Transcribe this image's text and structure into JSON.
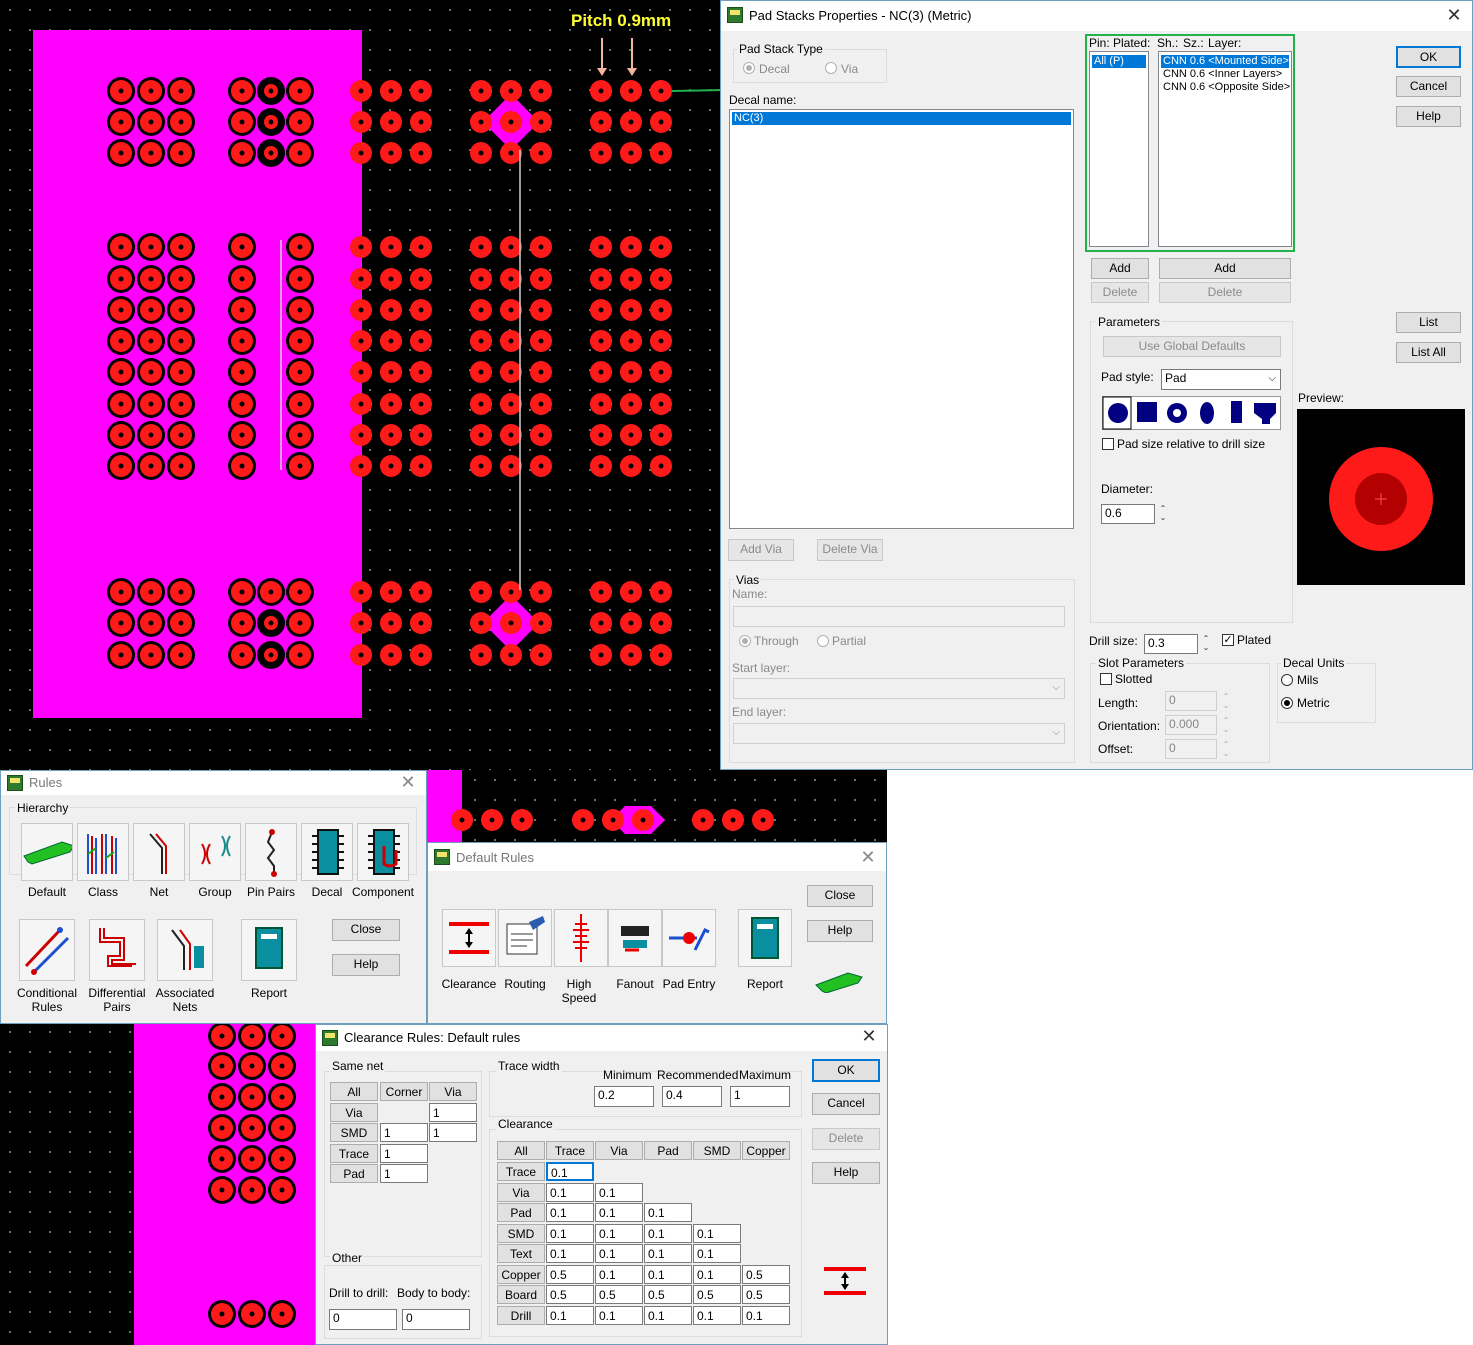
{
  "annotation": {
    "pitch_label": "Pitch 0.9mm"
  },
  "padstack": {
    "title": "Pad Stacks Properties - NC(3) (Metric)",
    "pad_stack_type_label": "Pad Stack Type",
    "decal_radio": "Decal",
    "via_radio": "Via",
    "decal_name_label": "Decal name:",
    "decal_items": [
      "NC(3)"
    ],
    "pin_header": "Pin:",
    "plated_header": "Plated:",
    "sh_header": "Sh.:",
    "sz_header": "Sz.:",
    "layer_header": "Layer:",
    "pin_items": [
      "All (P)"
    ],
    "layer_items": [
      "CNN 0.6 <Mounted Side>",
      "CNN 0.6 <Inner Layers>",
      "CNN 0.6 <Opposite Side>"
    ],
    "add_label": "Add",
    "delete_label": "Delete",
    "parameters_label": "Parameters",
    "use_global_defaults": "Use Global Defaults",
    "pad_style_label": "Pad style:",
    "pad_style_value": "Pad",
    "pad_relative_label": "Pad size relative to drill size",
    "diameter_label": "Diameter:",
    "diameter_value": "0.6",
    "preview_label": "Preview:",
    "drill_size_label": "Drill size:",
    "drill_size_value": "0.3",
    "plated_label": "Plated",
    "slot_params_label": "Slot Parameters",
    "slotted_label": "Slotted",
    "length_label": "Length:",
    "length_value": "0",
    "orientation_label": "Orientation:",
    "orientation_value": "0.000",
    "offset_label": "Offset:",
    "offset_value": "0",
    "decal_units_label": "Decal Units",
    "mils_label": "Mils",
    "metric_label": "Metric",
    "add_via": "Add Via",
    "delete_via": "Delete Via",
    "vias_label": "Vias",
    "name_label": "Name:",
    "through_label": "Through",
    "partial_label": "Partial",
    "start_layer_label": "Start layer:",
    "end_layer_label": "End layer:",
    "ok": "OK",
    "cancel": "Cancel",
    "help": "Help",
    "list": "List",
    "list_all": "List All"
  },
  "rules": {
    "title": "Rules",
    "hierarchy_label": "Hierarchy",
    "items": [
      {
        "label": "Default",
        "icon": "pcb-board-icon"
      },
      {
        "label": "Class",
        "icon": "class-traces-icon"
      },
      {
        "label": "Net",
        "icon": "net-trace-icon"
      },
      {
        "label": "Group",
        "icon": "group-icon"
      },
      {
        "label": "Pin Pairs",
        "icon": "pin-pairs-icon"
      },
      {
        "label": "Decal",
        "icon": "decal-chip-icon"
      },
      {
        "label": "Component",
        "icon": "component-chip-icon"
      }
    ],
    "conditional_l1": "Conditional",
    "conditional_l2": "Rules",
    "differential_l1": "Differential",
    "differential_l2": "Pairs",
    "associated_l1": "Associated",
    "associated_l2": "Nets",
    "report": "Report",
    "close": "Close",
    "help": "Help"
  },
  "default_rules": {
    "title": "Default Rules",
    "clearance": "Clearance",
    "routing": "Routing",
    "high_l1": "High",
    "high_l2": "Speed",
    "fanout": "Fanout",
    "pad_entry": "Pad Entry",
    "report": "Report",
    "close": "Close",
    "help": "Help"
  },
  "clearance": {
    "title": "Clearance Rules: Default rules",
    "same_net_label": "Same net",
    "trace_width_label": "Trace width",
    "minimum_label": "Minimum",
    "recommended_label": "Recommended",
    "maximum_label": "Maximum",
    "tw_min": "0.2",
    "tw_rec": "0.4",
    "tw_max": "1",
    "clearance_label": "Clearance",
    "other_label": "Other",
    "drill_to_drill_label": "Drill to drill:",
    "body_to_body_label": "Body to body:",
    "drill_to_drill": "0",
    "body_to_body": "0",
    "ok": "OK",
    "cancel": "Cancel",
    "delete": "Delete",
    "help": "Help",
    "same_net_cols": [
      "All",
      "Corner",
      "Via"
    ],
    "same_net_rows": [
      "Via",
      "SMD",
      "Trace",
      "Pad"
    ],
    "same_net_values": {
      "via_via": "1",
      "smd_corner": "1",
      "smd_via": "1",
      "trace_corner": "1",
      "pad_corner": "1"
    },
    "clr_cols": [
      "All",
      "Trace",
      "Via",
      "Pad",
      "SMD",
      "Copper"
    ],
    "clr_rows": [
      "Trace",
      "Via",
      "Pad",
      "SMD",
      "Text",
      "Copper",
      "Board",
      "Drill"
    ],
    "clr_values": [
      [
        "0.1"
      ],
      [
        "0.1",
        "0.1"
      ],
      [
        "0.1",
        "0.1",
        "0.1"
      ],
      [
        "0.1",
        "0.1",
        "0.1",
        "0.1"
      ],
      [
        "0.1",
        "0.1",
        "0.1",
        "0.1"
      ],
      [
        "0.5",
        "0.1",
        "0.1",
        "0.1",
        "0.5"
      ],
      [
        "0.5",
        "0.5",
        "0.5",
        "0.5",
        "0.5"
      ],
      [
        "0.1",
        "0.1",
        "0.1",
        "0.1",
        "0.1"
      ]
    ]
  },
  "colors": {
    "pad_red": "#ff1a1a",
    "copper_pour_magenta": "#ff00ff",
    "annotation_yellow": "#ffff33",
    "highlight_green": "#22b14c",
    "selection_blue": "#0078d7"
  }
}
